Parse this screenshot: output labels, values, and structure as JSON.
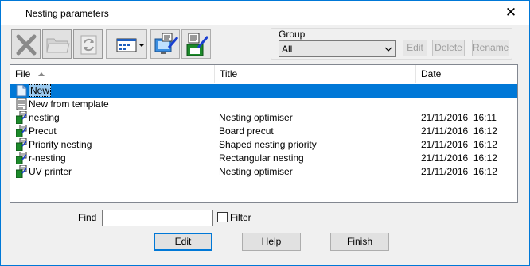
{
  "window": {
    "title": "Nesting parameters",
    "close_glyph": "✕"
  },
  "toolbar": {
    "buttons": [
      {
        "name": "delete-tool-icon",
        "state": "disabled"
      },
      {
        "name": "folder-icon",
        "state": "disabled"
      },
      {
        "name": "refresh-icon",
        "state": "disabled"
      },
      {
        "name": "view-mode-icon",
        "state": "enabled"
      },
      {
        "name": "edit-machine-icon",
        "state": "enabled"
      },
      {
        "name": "edit-file-icon",
        "state": "enabled"
      }
    ]
  },
  "group": {
    "label": "Group",
    "selected": "All",
    "buttons": {
      "edit": "Edit",
      "delete": "Delete",
      "rename": "Rename"
    }
  },
  "list": {
    "columns": [
      "File",
      "Title",
      "Date"
    ],
    "rows": [
      {
        "file": "New",
        "title": "",
        "date": "",
        "icon": "new-file-icon",
        "selected": true
      },
      {
        "file": "New from template",
        "title": "",
        "date": "",
        "icon": "template-icon",
        "selected": false
      },
      {
        "file": "nesting",
        "title": "Nesting optimiser",
        "date": "21/11/2016  16:11",
        "icon": "nesting-file-icon",
        "selected": false
      },
      {
        "file": "Precut",
        "title": "Board precut",
        "date": "21/11/2016  16:12",
        "icon": "nesting-file-icon",
        "selected": false
      },
      {
        "file": "Priority nesting",
        "title": "Shaped nesting priority",
        "date": "21/11/2016  16:12",
        "icon": "nesting-file-icon",
        "selected": false
      },
      {
        "file": "r-nesting",
        "title": "Rectangular nesting",
        "date": "21/11/2016  16:12",
        "icon": "nesting-file-icon",
        "selected": false
      },
      {
        "file": "UV printer",
        "title": "Nesting optimiser",
        "date": "21/11/2016  16:12",
        "icon": "nesting-file-icon",
        "selected": false
      }
    ]
  },
  "find": {
    "label": "Find",
    "value": "",
    "filter_label": "Filter",
    "filter_checked": false
  },
  "buttons": {
    "edit": "Edit",
    "help": "Help",
    "finish": "Finish"
  },
  "colors": {
    "accent": "#0078d7",
    "selection": "#0078d7"
  }
}
